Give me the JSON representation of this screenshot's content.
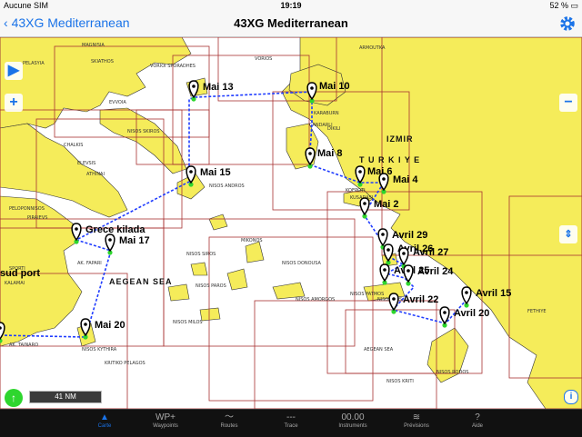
{
  "status": {
    "carrier": "Aucune SIM",
    "time": "19:19",
    "battery": "52 %"
  },
  "nav": {
    "back_label": "43XG Mediterranean",
    "title": "43XG Mediterranean"
  },
  "map": {
    "scale_label": "41 NM",
    "region_labels": {
      "aegean_sea": "AEGEAN SEA",
      "turkiye": "T U R K I Y E",
      "izmir": "IZMIR",
      "sud_port": "sud port"
    },
    "place_labels": [
      "MAGNISIA",
      "SKIATHOS",
      "VORIOI SPORADHES",
      "VORIOS",
      "ARMOUTKA",
      "PELASYIA",
      "EVVOIA",
      "NISOS SKIROS",
      "KARABURN",
      "CANDARLI",
      "DIKILI",
      "CHALKIS",
      "ELEVSIS",
      "ATHINAI",
      "NISOS ANDROS",
      "KUSADASI",
      "KOEPOTI",
      "PELOPONNISOS",
      "PIRAIEVS",
      "AK. FAPARI",
      "MIKONOS",
      "NISOS DONOUSA",
      "NISOS SIROS",
      "NISOS PAROS",
      "NISOS AMORGOS",
      "NISOS PATMOS",
      "NISOS KOS",
      "FETHIYE",
      "SPORTI",
      "KALAMAI",
      "AK. TAINARO",
      "NISOS MILOS",
      "NISOS KYTHIRA",
      "KRITIKO PELAGOS",
      "AEGEAN SEA",
      "NISOS KRITI",
      "NISOS RODOS"
    ],
    "waypoints": [
      "Mai 10",
      "Mai 13",
      "Mai 8",
      "Mai 15",
      "Mai 6",
      "Mai 4",
      "Mai 2",
      "Grece kilada",
      "Mai 17",
      "Avril 29",
      "Avril 26",
      "Avril 27",
      "Avril 25",
      "Avril 24",
      "Avril 22",
      "Avril 15",
      "Avril 20",
      "Mai 20",
      "27"
    ]
  },
  "tabs": [
    {
      "icon": "▲",
      "label": "Carte"
    },
    {
      "icon": "WP+",
      "label": "Waypoints"
    },
    {
      "icon": "〜",
      "label": "Routes"
    },
    {
      "icon": "---",
      "label": "Trace"
    },
    {
      "icon": "00.00",
      "label": "Instruments"
    },
    {
      "icon": "≋",
      "label": "Prévisions"
    },
    {
      "icon": "?",
      "label": "Aide"
    }
  ],
  "colors": {
    "land": "#f5ec5a",
    "route": "#1f3cff",
    "waypoint": "#2ed62e",
    "accent": "#1a73e8",
    "chart_border": "#a83232"
  }
}
